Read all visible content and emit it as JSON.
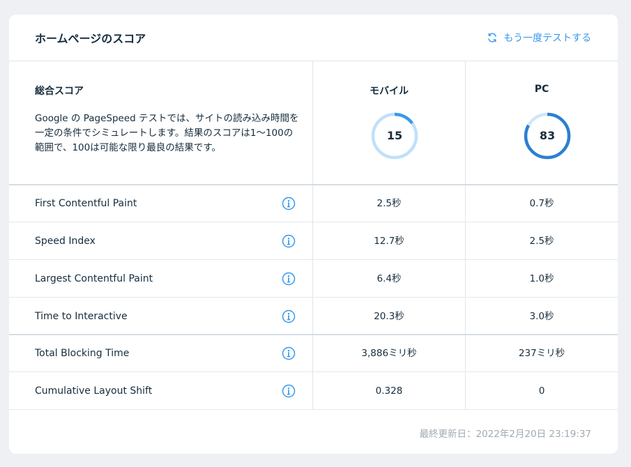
{
  "header": {
    "title": "ホームページのスコア",
    "retest_label": "もう一度テストする",
    "retest_icon": "refresh-icon",
    "accent_color": "#3899ec"
  },
  "overall": {
    "title": "総合スコア",
    "description": "Google の PageSpeed テストでは、サイトの読み込み時間を一定の条件でシミュレートします。結果のスコアは1〜100の範囲で、100は可能な限り最良の結果です。"
  },
  "columns": [
    {
      "label": "モバイル",
      "score": "15",
      "score_value": 15,
      "ring_color": "#3899ec",
      "track_color": "#bfe0fa"
    },
    {
      "label": "PC",
      "score": "83",
      "score_value": 83,
      "ring_color": "#2b7fd1",
      "track_color": "#cfe7fb"
    }
  ],
  "metrics": [
    {
      "label": "First Contentful Paint",
      "mobile": "2.5秒",
      "pc": "0.7秒"
    },
    {
      "label": "Speed Index",
      "mobile": "12.7秒",
      "pc": "2.5秒"
    },
    {
      "label": "Largest Contentful Paint",
      "mobile": "6.4秒",
      "pc": "1.0秒"
    },
    {
      "label": "Time to Interactive",
      "mobile": "20.3秒",
      "pc": "3.0秒"
    },
    {
      "label": "Total Blocking Time",
      "mobile": "3,886ミリ秒",
      "pc": "237ミリ秒"
    },
    {
      "label": "Cumulative Layout Shift",
      "mobile": "0.328",
      "pc": "0"
    }
  ],
  "footer": {
    "last_updated": "最終更新日：2022年2月20日 23:19:37"
  }
}
